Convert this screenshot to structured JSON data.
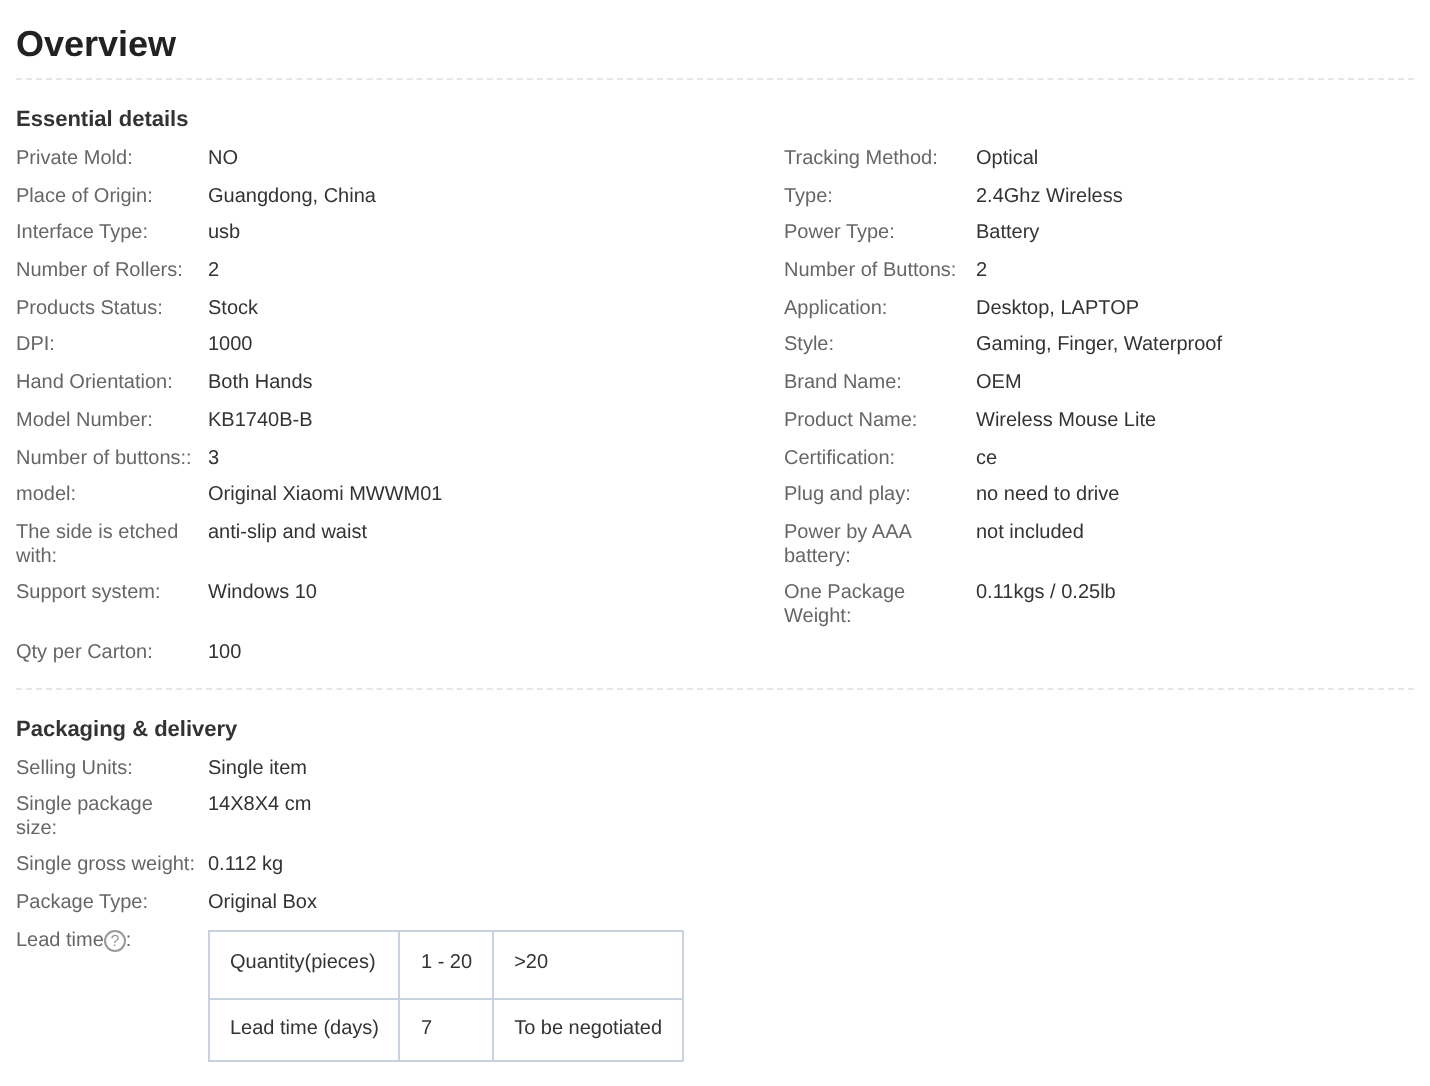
{
  "title": "Overview",
  "essential": {
    "heading": "Essential details",
    "left": [
      {
        "label": "Private Mold:",
        "value": "NO"
      },
      {
        "label": "Place of Origin:",
        "value": "Guangdong, China"
      },
      {
        "label": "Interface Type:",
        "value": "usb"
      },
      {
        "label": "Number of Rollers:",
        "value": "2"
      },
      {
        "label": "Products Status:",
        "value": "Stock"
      },
      {
        "label": "DPI:",
        "value": "1000"
      },
      {
        "label": "Hand Orientation:",
        "value": "Both Hands"
      },
      {
        "label": "Model Number:",
        "value": "KB1740B-B"
      },
      {
        "label": "Number of buttons::",
        "value": "3"
      },
      {
        "label": "model:",
        "value": "Original Xiaomi MWWM01"
      },
      {
        "label": "The side is etched with:",
        "value": "anti-slip and waist"
      },
      {
        "label": "Support system:",
        "value": "Windows 10"
      },
      {
        "label": "Qty per Carton:",
        "value": "100"
      }
    ],
    "right": [
      {
        "label": "Tracking Method:",
        "value": "Optical"
      },
      {
        "label": "Type:",
        "value": "2.4Ghz Wireless"
      },
      {
        "label": "Power Type:",
        "value": "Battery"
      },
      {
        "label": "Number of Buttons:",
        "value": "2"
      },
      {
        "label": "Application:",
        "value": "Desktop, LAPTOP"
      },
      {
        "label": "Style:",
        "value": "Gaming, Finger, Waterproof"
      },
      {
        "label": "Brand Name:",
        "value": "OEM"
      },
      {
        "label": "Product Name:",
        "value": "Wireless Mouse Lite"
      },
      {
        "label": "Certification:",
        "value": "ce"
      },
      {
        "label": "Plug and play:",
        "value": "no need to drive"
      },
      {
        "label": "Power by AAA battery:",
        "value": "not included"
      },
      {
        "label": "One Package Weight:",
        "value": "0.11kgs / 0.25lb"
      }
    ]
  },
  "packaging": {
    "heading": "Packaging & delivery",
    "items": [
      {
        "label": "Selling Units:",
        "value": "Single item"
      },
      {
        "label": "Single package size:",
        "value": "14X8X4 cm"
      },
      {
        "label": "Single gross weight:",
        "value": "0.112 kg"
      },
      {
        "label": "Package Type:",
        "value": "Original Box"
      }
    ],
    "lead_time": {
      "label": "Lead time",
      "help": "?",
      "suffix": ":",
      "rows": [
        [
          "Quantity(pieces)",
          "1 - 20",
          ">20"
        ],
        [
          "Lead time (days)",
          "7",
          "To be negotiated"
        ]
      ]
    }
  }
}
